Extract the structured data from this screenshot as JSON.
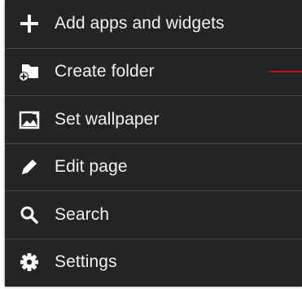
{
  "menu": {
    "items": [
      {
        "icon": "plus-icon",
        "label": "Add apps and widgets"
      },
      {
        "icon": "create-folder-icon",
        "label": "Create folder"
      },
      {
        "icon": "wallpaper-icon",
        "label": "Set wallpaper"
      },
      {
        "icon": "pencil-icon",
        "label": "Edit page"
      },
      {
        "icon": "search-icon",
        "label": "Search"
      },
      {
        "icon": "gear-icon",
        "label": "Settings"
      }
    ]
  },
  "colors": {
    "menu_background": "#222426",
    "divider": "#4a4c4e",
    "text": "#f2f2f2",
    "annotation_line": "#c0121a"
  }
}
